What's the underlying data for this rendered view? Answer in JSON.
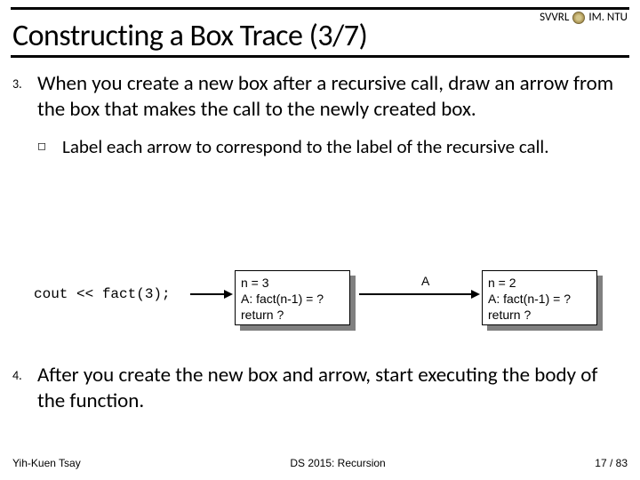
{
  "header": {
    "org_left": "SVVRL",
    "org_right": "IM. NTU"
  },
  "title": "Constructing a Box Trace (3/7)",
  "items": [
    {
      "num": "3.",
      "text": "When you create a new box after a recursive call, draw an arrow from the box that makes the call to the newly created box.",
      "sub_marker": "◻",
      "sub_text": "Label each arrow to correspond to the label of the recursive call."
    },
    {
      "num": "4.",
      "text": "After you create the new box and arrow, start executing the body of the function."
    }
  ],
  "diagram": {
    "code": "cout << fact(3);",
    "arrow_label": "A",
    "box1": {
      "line1": "n = 3",
      "line2": "A: fact(n-1) = ?",
      "line3": "return ?"
    },
    "box2": {
      "line1": "n = 2",
      "line2": "A: fact(n-1) = ?",
      "line3": "return ?"
    }
  },
  "footer": {
    "left": "Yih-Kuen Tsay",
    "center": "DS 2015: Recursion",
    "right": "17 / 83"
  }
}
